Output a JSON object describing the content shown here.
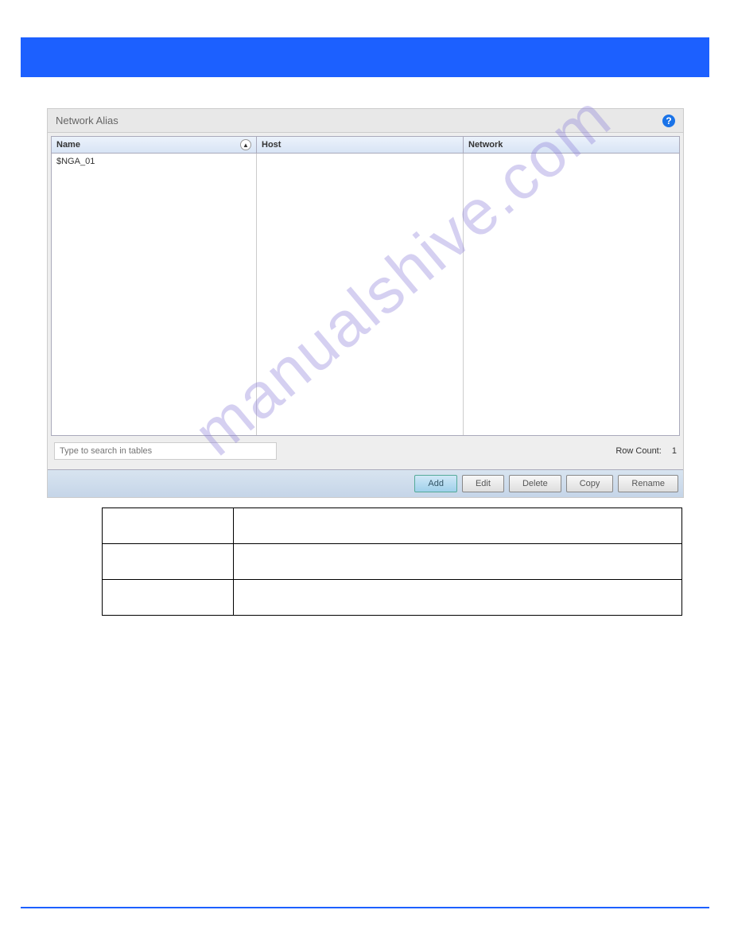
{
  "panel": {
    "title": "Network Alias"
  },
  "columns": {
    "name": "Name",
    "host": "Host",
    "network": "Network"
  },
  "rows": [
    {
      "name": "$NGA_01",
      "host": "",
      "network": ""
    }
  ],
  "search": {
    "placeholder": "Type to search in tables"
  },
  "row_count": {
    "label": "Row Count:",
    "value": "1"
  },
  "buttons": {
    "add": "Add",
    "edit": "Edit",
    "delete": "Delete",
    "copy": "Copy",
    "rename": "Rename"
  },
  "watermark": "manualshive.com"
}
